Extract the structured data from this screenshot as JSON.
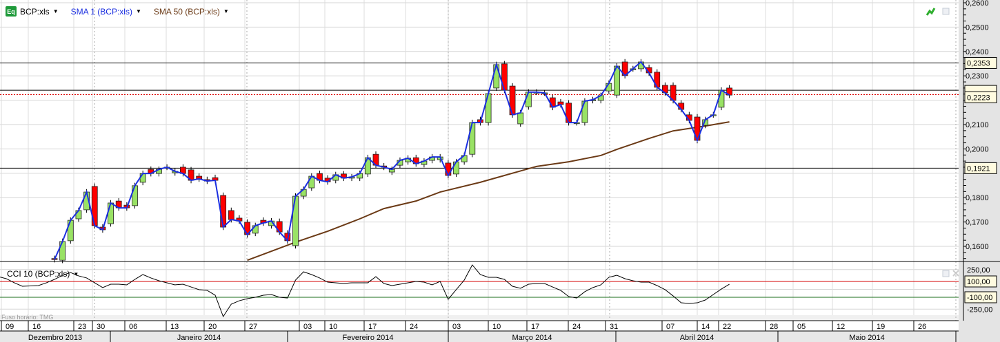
{
  "legend": {
    "symbol_badge": "Eq",
    "symbol": "BCP:xls",
    "sma1": "SMA 1 (BCP:xls)",
    "sma50": "SMA 50 (BCP:xls)",
    "cci": "CCI 10 (BCP:xls)"
  },
  "timezone": "Fuso horário: TMG",
  "colors": {
    "up": "#99e265",
    "down": "#ff0000",
    "sma1": "#1a2ee0",
    "sma50": "#6b3a16",
    "cci": "#000000",
    "cci_upper": "#d40000",
    "cci_lower": "#1a6e1a"
  },
  "chart_data": [
    {
      "type": "candlestick",
      "title": "BCP:xls",
      "ylim": [
        0.155,
        0.26
      ],
      "y_ticks": [
        "0,2600",
        "0,2500",
        "0,2400",
        "0,2300",
        "0,2100",
        "0,2000",
        "0,1800",
        "0,1700",
        "0,1600"
      ],
      "y_tick_values": [
        0.26,
        0.25,
        0.24,
        0.23,
        0.21,
        0.2,
        0.18,
        0.17,
        0.16
      ],
      "price_lines": [
        {
          "value": 0.2353,
          "label": "0,2353"
        },
        {
          "value": 0.2241,
          "label": ""
        },
        {
          "value": 0.1921,
          "label": "0,1921"
        }
      ],
      "last_price": {
        "value": 0.2223,
        "label": "0,2223"
      },
      "candles": [
        [
          0.155,
          0.1546
        ],
        [
          0.1543,
          0.162
        ],
        [
          0.1623,
          0.1707
        ],
        [
          0.1713,
          0.1747
        ],
        [
          0.175,
          0.1823
        ],
        [
          0.1846,
          0.1685
        ],
        [
          0.1679,
          0.1668
        ],
        [
          0.1693,
          0.1778
        ],
        [
          0.1786,
          0.1758
        ],
        [
          0.1769,
          0.1758
        ],
        [
          0.1767,
          0.1849
        ],
        [
          0.1863,
          0.1899
        ],
        [
          0.1916,
          0.1899
        ],
        [
          0.1899,
          0.1916
        ],
        [
          0.1925,
          0.1925
        ],
        [
          0.1902,
          0.1908
        ],
        [
          0.1925,
          0.1899
        ],
        [
          0.1914,
          0.1871
        ],
        [
          0.1888,
          0.1877
        ],
        [
          0.1874,
          0.1868
        ],
        [
          0.1882,
          0.1871
        ],
        [
          0.1809,
          0.1679
        ],
        [
          0.1747,
          0.171
        ],
        [
          0.1716,
          0.1704
        ],
        [
          0.1699,
          0.1648
        ],
        [
          0.1654,
          0.1685
        ],
        [
          0.1707,
          0.1696
        ],
        [
          0.1685,
          0.1704
        ],
        [
          0.1702,
          0.1659
        ],
        [
          0.1654,
          0.1623
        ],
        [
          0.1603,
          0.1806
        ],
        [
          0.1806,
          0.1834
        ],
        [
          0.184,
          0.1888
        ],
        [
          0.1899,
          0.1871
        ],
        [
          0.188,
          0.1865
        ],
        [
          0.1871,
          0.1894
        ],
        [
          0.1897,
          0.188
        ],
        [
          0.188,
          0.1885
        ],
        [
          0.188,
          0.1899
        ],
        [
          0.1897,
          0.1964
        ],
        [
          0.1978,
          0.1933
        ],
        [
          0.193,
          0.1925
        ],
        [
          0.1905,
          0.1916
        ],
        [
          0.1933,
          0.1953
        ],
        [
          0.1947,
          0.1962
        ],
        [
          0.1964,
          0.1939
        ],
        [
          0.1936,
          0.195
        ],
        [
          0.1953,
          0.1967
        ],
        [
          0.1956,
          0.1967
        ],
        [
          0.1942,
          0.1891
        ],
        [
          0.1897,
          0.1947
        ],
        [
          0.1947,
          0.1973
        ],
        [
          0.1978,
          0.2108
        ],
        [
          0.212,
          0.2108
        ],
        [
          0.2108,
          0.2227
        ],
        [
          0.225,
          0.2346
        ],
        [
          0.2349,
          0.2241
        ],
        [
          0.2258,
          0.214
        ],
        [
          0.2103,
          0.2148
        ],
        [
          0.2173,
          0.2233
        ],
        [
          0.2233,
          0.2233
        ],
        [
          0.223,
          0.223
        ],
        [
          0.221,
          0.2171
        ],
        [
          0.2193,
          0.2182
        ],
        [
          0.2188,
          0.2108
        ],
        [
          0.2108,
          0.2108
        ],
        [
          0.2108,
          0.2196
        ],
        [
          0.2199,
          0.2202
        ],
        [
          0.2199,
          0.2219
        ],
        [
          0.2238,
          0.2269
        ],
        [
          0.2221,
          0.234
        ],
        [
          0.2357,
          0.2301
        ],
        [
          0.2329,
          0.2329
        ],
        [
          0.2329,
          0.2357
        ],
        [
          0.2334,
          0.2312
        ],
        [
          0.2315,
          0.2253
        ],
        [
          0.2261,
          0.223
        ],
        [
          0.2261,
          0.2199
        ],
        [
          0.2188,
          0.2162
        ],
        [
          0.214,
          0.2117
        ],
        [
          0.2131,
          0.2035
        ],
        [
          0.2097,
          0.212
        ],
        [
          0.214,
          0.214
        ],
        [
          0.2171,
          0.2241
        ],
        [
          0.225,
          0.2221
        ]
      ],
      "sma50": [
        [
          24,
          0.1543
        ],
        [
          30,
          0.1617
        ],
        [
          34,
          0.1662
        ],
        [
          38,
          0.1713
        ],
        [
          41,
          0.1755
        ],
        [
          45,
          0.1786
        ],
        [
          48,
          0.1823
        ],
        [
          53,
          0.1863
        ],
        [
          56,
          0.1891
        ],
        [
          60,
          0.1928
        ],
        [
          64,
          0.1947
        ],
        [
          68,
          0.1973
        ],
        [
          70,
          0.1998
        ],
        [
          74,
          0.2043
        ],
        [
          77,
          0.2074
        ],
        [
          81,
          0.2094
        ],
        [
          84,
          0.2111
        ]
      ]
    },
    {
      "type": "line",
      "title": "CCI 10 (BCP:xls)",
      "ylim": [
        -250,
        250
      ],
      "y_ticks": [
        "250,00",
        "-250,00"
      ],
      "y_tick_values": [
        250,
        -250
      ],
      "levels": [
        {
          "value": 100,
          "label": "100,00"
        },
        {
          "value": -100,
          "label": "-100,00"
        }
      ],
      "start_index": -7,
      "values": [
        161,
        135,
        83,
        39,
        43,
        48,
        83,
        126,
        178,
        213,
        170,
        144,
        83,
        22,
        65,
        65,
        57,
        126,
        187,
        144,
        109,
        83,
        57,
        65,
        30,
        -4,
        -13,
        -74,
        -344,
        -187,
        -144,
        -117,
        -100,
        -74,
        -65,
        -100,
        -109,
        117,
        222,
        187,
        144,
        91,
        83,
        74,
        83,
        83,
        83,
        161,
        74,
        48,
        65,
        83,
        100,
        91,
        57,
        100,
        -126,
        -4,
        117,
        309,
        187,
        152,
        152,
        126,
        39,
        13,
        65,
        74,
        74,
        30,
        -13,
        -91,
        -109,
        -30,
        22,
        57,
        152,
        178,
        135,
        109,
        91,
        91,
        48,
        -4,
        -83,
        -170,
        -178,
        -170,
        -135,
        -65,
        4,
        65
      ]
    }
  ],
  "x_axis": {
    "days": [
      "09",
      "16",
      "23",
      "30",
      "06",
      "13",
      "20",
      "27",
      "03",
      "10",
      "17",
      "24",
      "03",
      "10",
      "17",
      "24",
      "31",
      "07",
      "14",
      "22",
      "28",
      "05",
      "12",
      "19",
      "26"
    ],
    "months": [
      "Dezembro 2013",
      "Janeiro 2014",
      "Fevereiro 2014",
      "Março 2014",
      "Abril 2014",
      "Maio 2014"
    ]
  }
}
